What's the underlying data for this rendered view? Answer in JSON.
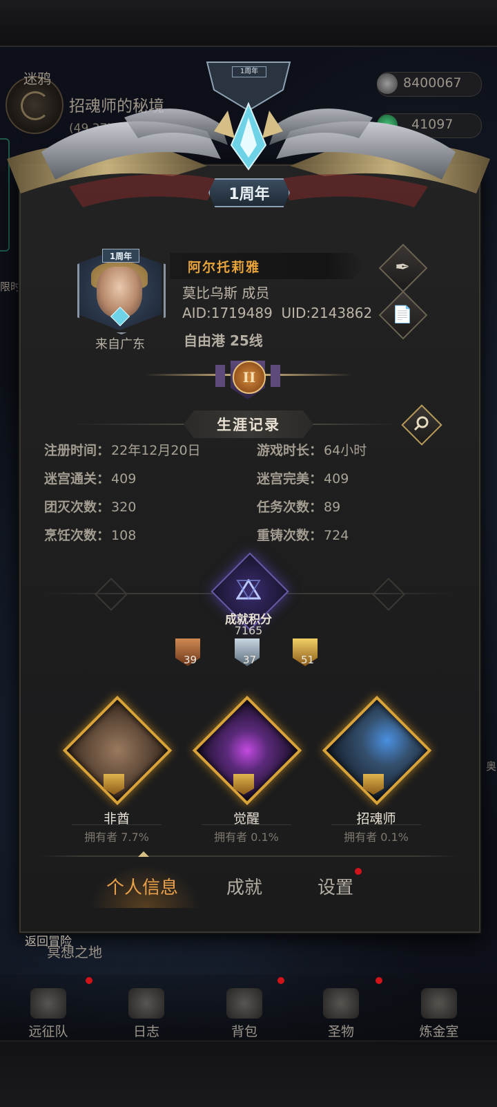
{
  "hud": {
    "region_name": "迷鸦",
    "location_name": "招魂师的秘境",
    "location_coords": "(49,37)",
    "resource_1": "8400067",
    "resource_2": "41097",
    "side_text_left": "限时",
    "side_text_right": "奥",
    "return_label": "返回冒险",
    "zone_label": "冥想之地"
  },
  "profile": {
    "anniversary_badge": "1周年",
    "avatar_badge": "1周年",
    "name": "阿尔托莉雅",
    "guild": "莫比乌斯 成员",
    "ids": "AID:1719489  UID:2143862",
    "server": "自由港 25线",
    "origin": "来自广东",
    "rank_numeral": "II"
  },
  "career": {
    "title": "生涯记录",
    "stats": [
      {
        "label": "注册时间：",
        "value": "22年12月20日"
      },
      {
        "label": "游戏时长：",
        "value": "64小时"
      },
      {
        "label": "迷宫通关：",
        "value": "409"
      },
      {
        "label": "迷宫完美：",
        "value": "409"
      },
      {
        "label": "团灭次数：",
        "value": "320"
      },
      {
        "label": "任务次数：",
        "value": "89"
      },
      {
        "label": "烹饪次数：",
        "value": "108"
      },
      {
        "label": "重铸次数：",
        "value": "724"
      }
    ]
  },
  "achievement": {
    "label": "成就积分",
    "score": "7165",
    "medals": [
      {
        "tier": "bronze",
        "count": "39",
        "color": "#b06a3a"
      },
      {
        "tier": "silver",
        "count": "37",
        "color": "#9fb2c4"
      },
      {
        "tier": "gold",
        "count": "51",
        "color": "#d6a93a"
      }
    ]
  },
  "showcase": [
    {
      "title": "非酋",
      "owner": "拥有者 7.7%",
      "color": "#7a5a46"
    },
    {
      "title": "觉醒",
      "owner": "拥有者 0.1%",
      "color": "#5a2a7a"
    },
    {
      "title": "招魂师",
      "owner": "拥有者 0.1%",
      "color": "#34506e"
    }
  ],
  "tabs": [
    {
      "label": "个人信息",
      "active": true
    },
    {
      "label": "成就",
      "active": false
    },
    {
      "label": "设置",
      "active": false
    }
  ],
  "bottom_nav": [
    {
      "label": "远征队",
      "icon": "helmet-icon"
    },
    {
      "label": "日志",
      "icon": "map-icon"
    },
    {
      "label": "背包",
      "icon": "bag-icon"
    },
    {
      "label": "圣物",
      "icon": "torch-icon"
    },
    {
      "label": "炼金室",
      "icon": "alchemy-icon"
    }
  ],
  "colors": {
    "name_gold": "#e9a53c",
    "tab_active": "#e9a04a",
    "tab_inactive": "#b3ada3",
    "notification_red": "#d0141a"
  }
}
